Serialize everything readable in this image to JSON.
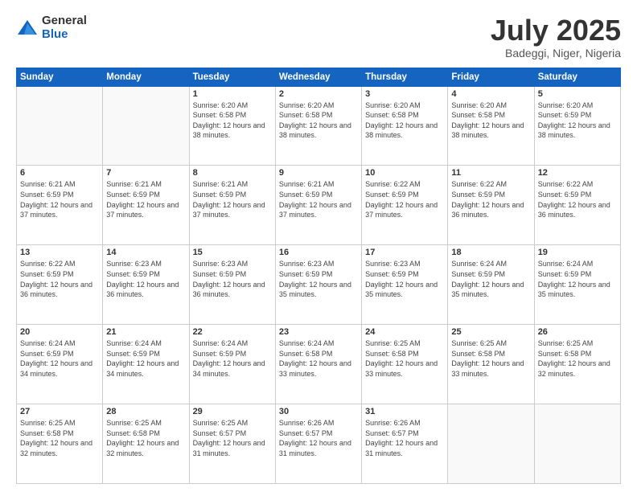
{
  "logo": {
    "general": "General",
    "blue": "Blue"
  },
  "header": {
    "month": "July 2025",
    "location": "Badeggi, Niger, Nigeria"
  },
  "weekdays": [
    "Sunday",
    "Monday",
    "Tuesday",
    "Wednesday",
    "Thursday",
    "Friday",
    "Saturday"
  ],
  "weeks": [
    [
      {
        "day": "",
        "info": ""
      },
      {
        "day": "",
        "info": ""
      },
      {
        "day": "1",
        "info": "Sunrise: 6:20 AM\nSunset: 6:58 PM\nDaylight: 12 hours and 38 minutes."
      },
      {
        "day": "2",
        "info": "Sunrise: 6:20 AM\nSunset: 6:58 PM\nDaylight: 12 hours and 38 minutes."
      },
      {
        "day": "3",
        "info": "Sunrise: 6:20 AM\nSunset: 6:58 PM\nDaylight: 12 hours and 38 minutes."
      },
      {
        "day": "4",
        "info": "Sunrise: 6:20 AM\nSunset: 6:58 PM\nDaylight: 12 hours and 38 minutes."
      },
      {
        "day": "5",
        "info": "Sunrise: 6:20 AM\nSunset: 6:59 PM\nDaylight: 12 hours and 38 minutes."
      }
    ],
    [
      {
        "day": "6",
        "info": "Sunrise: 6:21 AM\nSunset: 6:59 PM\nDaylight: 12 hours and 37 minutes."
      },
      {
        "day": "7",
        "info": "Sunrise: 6:21 AM\nSunset: 6:59 PM\nDaylight: 12 hours and 37 minutes."
      },
      {
        "day": "8",
        "info": "Sunrise: 6:21 AM\nSunset: 6:59 PM\nDaylight: 12 hours and 37 minutes."
      },
      {
        "day": "9",
        "info": "Sunrise: 6:21 AM\nSunset: 6:59 PM\nDaylight: 12 hours and 37 minutes."
      },
      {
        "day": "10",
        "info": "Sunrise: 6:22 AM\nSunset: 6:59 PM\nDaylight: 12 hours and 37 minutes."
      },
      {
        "day": "11",
        "info": "Sunrise: 6:22 AM\nSunset: 6:59 PM\nDaylight: 12 hours and 36 minutes."
      },
      {
        "day": "12",
        "info": "Sunrise: 6:22 AM\nSunset: 6:59 PM\nDaylight: 12 hours and 36 minutes."
      }
    ],
    [
      {
        "day": "13",
        "info": "Sunrise: 6:22 AM\nSunset: 6:59 PM\nDaylight: 12 hours and 36 minutes."
      },
      {
        "day": "14",
        "info": "Sunrise: 6:23 AM\nSunset: 6:59 PM\nDaylight: 12 hours and 36 minutes."
      },
      {
        "day": "15",
        "info": "Sunrise: 6:23 AM\nSunset: 6:59 PM\nDaylight: 12 hours and 36 minutes."
      },
      {
        "day": "16",
        "info": "Sunrise: 6:23 AM\nSunset: 6:59 PM\nDaylight: 12 hours and 35 minutes."
      },
      {
        "day": "17",
        "info": "Sunrise: 6:23 AM\nSunset: 6:59 PM\nDaylight: 12 hours and 35 minutes."
      },
      {
        "day": "18",
        "info": "Sunrise: 6:24 AM\nSunset: 6:59 PM\nDaylight: 12 hours and 35 minutes."
      },
      {
        "day": "19",
        "info": "Sunrise: 6:24 AM\nSunset: 6:59 PM\nDaylight: 12 hours and 35 minutes."
      }
    ],
    [
      {
        "day": "20",
        "info": "Sunrise: 6:24 AM\nSunset: 6:59 PM\nDaylight: 12 hours and 34 minutes."
      },
      {
        "day": "21",
        "info": "Sunrise: 6:24 AM\nSunset: 6:59 PM\nDaylight: 12 hours and 34 minutes."
      },
      {
        "day": "22",
        "info": "Sunrise: 6:24 AM\nSunset: 6:59 PM\nDaylight: 12 hours and 34 minutes."
      },
      {
        "day": "23",
        "info": "Sunrise: 6:24 AM\nSunset: 6:58 PM\nDaylight: 12 hours and 33 minutes."
      },
      {
        "day": "24",
        "info": "Sunrise: 6:25 AM\nSunset: 6:58 PM\nDaylight: 12 hours and 33 minutes."
      },
      {
        "day": "25",
        "info": "Sunrise: 6:25 AM\nSunset: 6:58 PM\nDaylight: 12 hours and 33 minutes."
      },
      {
        "day": "26",
        "info": "Sunrise: 6:25 AM\nSunset: 6:58 PM\nDaylight: 12 hours and 32 minutes."
      }
    ],
    [
      {
        "day": "27",
        "info": "Sunrise: 6:25 AM\nSunset: 6:58 PM\nDaylight: 12 hours and 32 minutes."
      },
      {
        "day": "28",
        "info": "Sunrise: 6:25 AM\nSunset: 6:58 PM\nDaylight: 12 hours and 32 minutes."
      },
      {
        "day": "29",
        "info": "Sunrise: 6:25 AM\nSunset: 6:57 PM\nDaylight: 12 hours and 31 minutes."
      },
      {
        "day": "30",
        "info": "Sunrise: 6:26 AM\nSunset: 6:57 PM\nDaylight: 12 hours and 31 minutes."
      },
      {
        "day": "31",
        "info": "Sunrise: 6:26 AM\nSunset: 6:57 PM\nDaylight: 12 hours and 31 minutes."
      },
      {
        "day": "",
        "info": ""
      },
      {
        "day": "",
        "info": ""
      }
    ]
  ]
}
